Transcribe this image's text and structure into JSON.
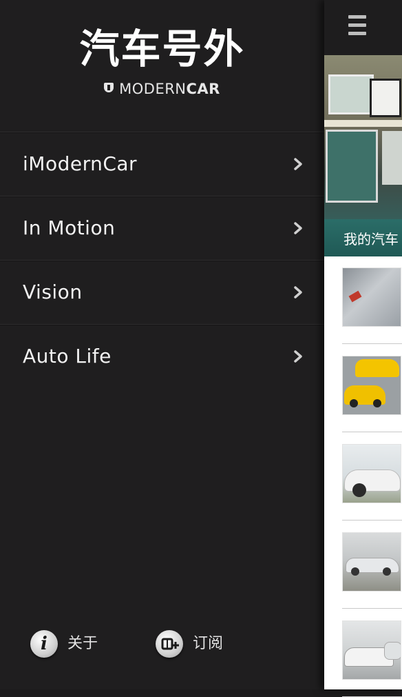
{
  "brand": {
    "name_cn": "汽车号外",
    "name_en_light": "MODERN",
    "name_en_bold": "CAR"
  },
  "menu": {
    "items": [
      {
        "label": "iModernCar"
      },
      {
        "label": "In Motion"
      },
      {
        "label": "Vision"
      },
      {
        "label": "Auto Life"
      }
    ]
  },
  "footer": {
    "about_label": "关于",
    "subscribe_label": "订阅"
  },
  "main": {
    "featured_caption": "我的汽车"
  },
  "colors": {
    "drawer_bg": "#1f1e1f",
    "featured_caption_bg": "#2b6d68"
  },
  "icons": [
    "chevron-right-icon",
    "info-icon",
    "subscribe-icon",
    "hamburger-menu-icon"
  ]
}
